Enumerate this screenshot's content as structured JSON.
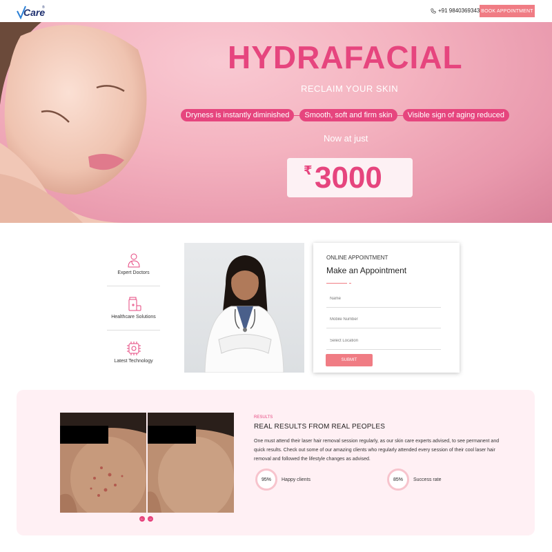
{
  "header": {
    "logo_text": "Care",
    "logo_reg": "®",
    "phone": "+91 9840369343",
    "book_label": "BOOK APPOINTMENT"
  },
  "hero": {
    "title": "HYDRAFACIAL",
    "subtitle": "RECLAIM YOUR SKIN",
    "pills": [
      "Dryness is instantly diminished",
      "Smooth, soft and firm skin",
      "Visible sign of aging reduced"
    ],
    "now_text": "Now at just",
    "currency": "₹",
    "price": "3000"
  },
  "features": [
    {
      "label": "Expert Doctors",
      "icon": "doctor-icon"
    },
    {
      "label": "Healthcare Solutions",
      "icon": "medicine-icon"
    },
    {
      "label": "Latest Technology",
      "icon": "chip-icon"
    }
  ],
  "form": {
    "kicker": "ONLINE APPOINTMENT",
    "title": "Make an Appointment",
    "name_placeholder": "Name",
    "mobile_placeholder": "Mobile Number",
    "location_placeholder": "Select Location",
    "submit_label": "SUBMIT"
  },
  "results": {
    "kicker": "RESULTS",
    "title": "REAL RESULTS FROM REAL PEOPLES",
    "body": "One must attend their laser hair removal session regularly, as our skin care experts advised, to see permanent and quick results. Check out some of our amazing clients who regularly attended every session of their cool laser hair removal and followed the lifestyle changes as advised.",
    "prev": "←",
    "next": "→",
    "stats": [
      {
        "value": "95%",
        "label": "Happy clients"
      },
      {
        "value": "85%",
        "label": "Success rate"
      }
    ]
  },
  "colors": {
    "accent": "#e6457e",
    "button": "#f07c84",
    "hero_bg": "#f4b3c0",
    "results_bg": "#fff0f4"
  }
}
